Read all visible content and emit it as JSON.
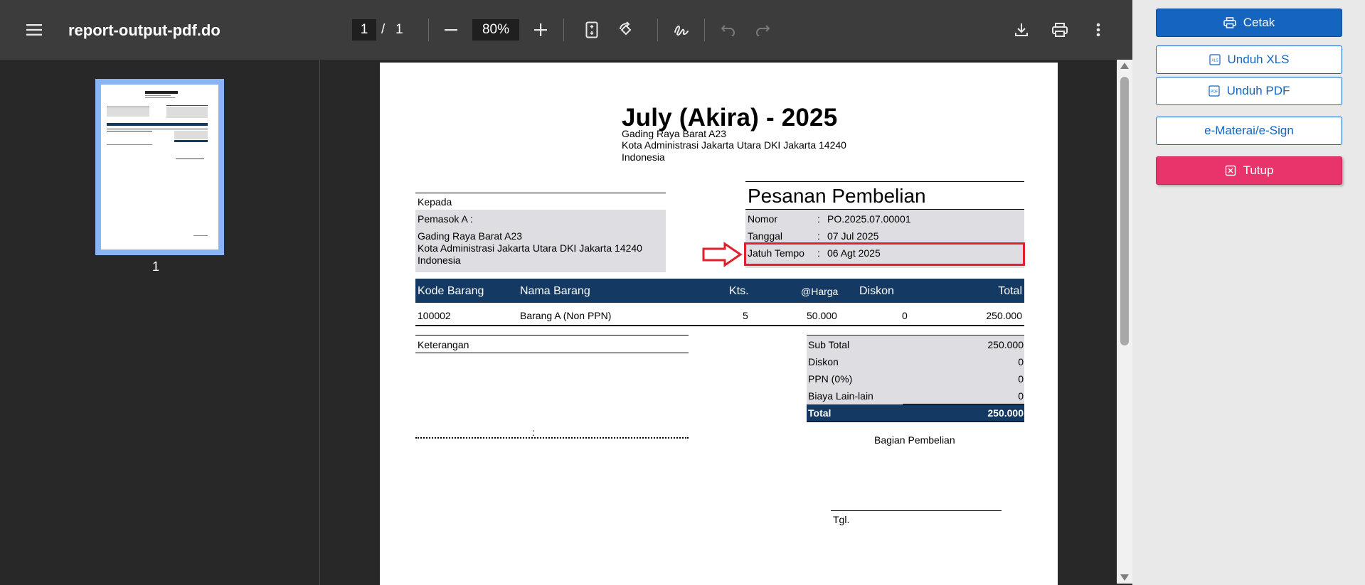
{
  "toolbar": {
    "doc_title": "report-output-pdf.do",
    "page_current": "1",
    "page_sep": "/",
    "page_total": "1",
    "zoom": "80%",
    "icons": [
      "menu-icon",
      "zoom-out-icon",
      "zoom-in-icon",
      "fit-page-icon",
      "rotate-icon",
      "draw-icon",
      "undo-icon",
      "redo-icon",
      "download-icon",
      "print-icon",
      "more-icon"
    ]
  },
  "sidebar": {
    "thumbnail_label": "1"
  },
  "document": {
    "company_name": "July (Akira) - 2025",
    "company_address": [
      "Gading Raya Barat A23",
      "Kota Administrasi Jakarta Utara DKI Jakarta 14240",
      "Indonesia"
    ],
    "kepada_label": "Kepada",
    "supplier_label": "Pemasok A  :",
    "supplier_address": [
      "Gading Raya Barat A23",
      "Kota Administrasi Jakarta Utara DKI Jakarta 14240",
      "Indonesia"
    ],
    "doc_type": "Pesanan Pembelian",
    "meta": [
      {
        "label": "Nomor",
        "sep": ":",
        "value": "PO.2025.07.00001"
      },
      {
        "label": "Tanggal",
        "sep": ":",
        "value": "07 Jul 2025"
      },
      {
        "label": "Jatuh Tempo",
        "sep": ":",
        "value": "06 Agt 2025"
      }
    ],
    "columns": [
      "Kode Barang",
      "Nama Barang",
      "Kts.",
      "@Harga",
      "Diskon",
      "Total"
    ],
    "rows": [
      {
        "kode": "100002",
        "nama": "Barang A (Non PPN)",
        "kts": "5",
        "harga": "50.000",
        "diskon": "0",
        "total": "250.000"
      }
    ],
    "notes_label": "Keterangan",
    "notes_colon": ":",
    "totals": [
      {
        "label": "Sub Total",
        "value": "250.000"
      },
      {
        "label": "Diskon",
        "value": "0"
      },
      {
        "label": "PPN (0%)",
        "value": "0"
      },
      {
        "label": "Biaya Lain-lain",
        "value": "0"
      }
    ],
    "grand_total_label": "Total",
    "grand_total_value": "250.000",
    "signature_role": "Bagian Pembelian",
    "signature_date_label": "Tgl.",
    "highlight_color": "#e0202a",
    "header_band_color": "#143a63"
  },
  "panel": {
    "cetak": "Cetak",
    "unduh_xls": "Unduh XLS",
    "unduh_pdf": "Unduh PDF",
    "emeterai": "e-Materai/e-Sign",
    "tutup": "Tutup",
    "colors": {
      "primary": "#1565c0",
      "danger": "#e8336b"
    }
  }
}
